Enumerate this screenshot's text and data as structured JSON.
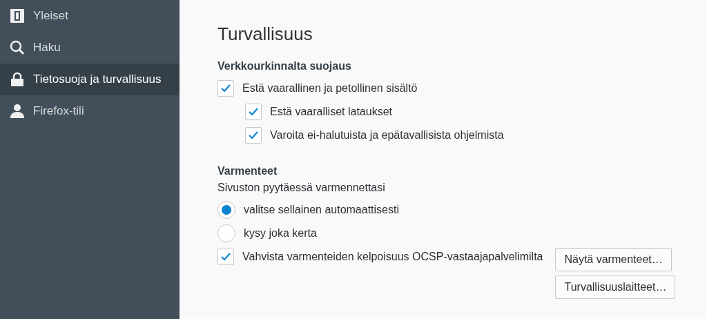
{
  "sidebar": {
    "items": [
      {
        "label": "Yleiset",
        "selected": false
      },
      {
        "label": "Haku",
        "selected": false
      },
      {
        "label": "Tietosuoja ja turvallisuus",
        "selected": true
      },
      {
        "label": "Firefox-tili",
        "selected": false
      }
    ]
  },
  "main": {
    "title": "Turvallisuus",
    "sections": [
      {
        "heading": "Verkkourkinnalta suojaus",
        "options": [
          {
            "kind": "checkbox",
            "label": "Estä vaarallinen ja petollinen sisältö",
            "checked": true,
            "children": [
              {
                "kind": "checkbox",
                "label": "Estä vaaralliset lataukset",
                "checked": true
              },
              {
                "kind": "checkbox",
                "label": "Varoita ei-halutuista ja epätavallisista ohjelmista",
                "checked": true
              }
            ]
          }
        ]
      },
      {
        "heading": "Varmenteet",
        "description": "Sivuston pyytäessä varmennettasi",
        "options": [
          {
            "kind": "radio",
            "label": "valitse sellainen automaattisesti",
            "selected": true
          },
          {
            "kind": "radio",
            "label": "kysy joka kerta",
            "selected": false
          },
          {
            "kind": "checkbox",
            "label": "Vahvista varmenteiden kelpoisuus OCSP-vastaajapalvelimilta",
            "checked": true
          }
        ],
        "buttons": [
          "Näytä varmenteet…",
          "Turvallisuuslaitteet…"
        ]
      }
    ]
  }
}
